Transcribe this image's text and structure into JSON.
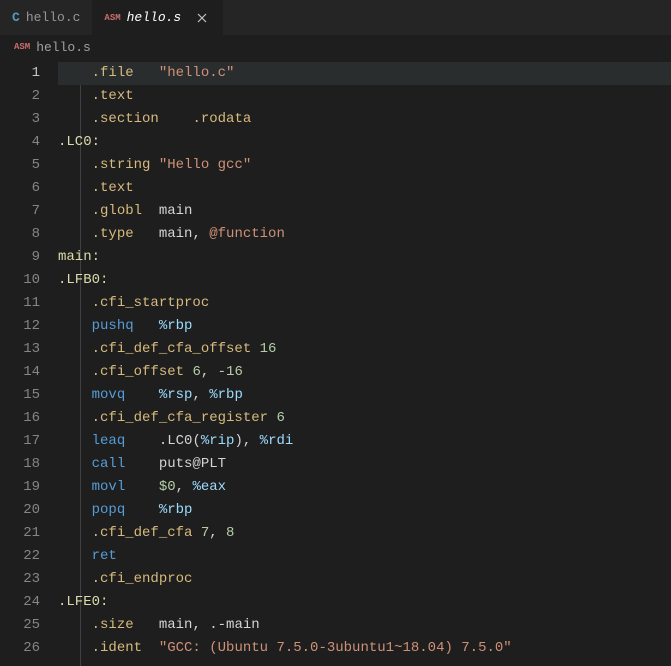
{
  "tabs": [
    {
      "icon": "C",
      "iconClass": "c-icon",
      "label": "hello.c",
      "active": false
    },
    {
      "icon": "ASM",
      "iconClass": "asm-icon",
      "label": "hello.s",
      "active": true
    }
  ],
  "breadcrumb": {
    "icon": "ASM",
    "label": "hello.s"
  },
  "activeLine": 1,
  "code": [
    [
      {
        "t": "    ",
        "c": "l"
      },
      {
        "t": ".file   ",
        "c": "d"
      },
      {
        "t": "\"hello.c\"",
        "c": "s"
      }
    ],
    [
      {
        "t": "    ",
        "c": "l"
      },
      {
        "t": ".text",
        "c": "d"
      }
    ],
    [
      {
        "t": "    ",
        "c": "l"
      },
      {
        "t": ".section    ",
        "c": "d"
      },
      {
        "t": ".rodata",
        "c": "d"
      }
    ],
    [
      {
        "t": ".LC0:",
        "c": "f"
      }
    ],
    [
      {
        "t": "    ",
        "c": "l"
      },
      {
        "t": ".string ",
        "c": "d"
      },
      {
        "t": "\"Hello gcc\"",
        "c": "s"
      }
    ],
    [
      {
        "t": "    ",
        "c": "l"
      },
      {
        "t": ".text",
        "c": "d"
      }
    ],
    [
      {
        "t": "    ",
        "c": "l"
      },
      {
        "t": ".globl  ",
        "c": "d"
      },
      {
        "t": "main",
        "c": "c"
      }
    ],
    [
      {
        "t": "    ",
        "c": "l"
      },
      {
        "t": ".type   ",
        "c": "d"
      },
      {
        "t": "main",
        "c": "c"
      },
      {
        "t": ", ",
        "c": "l"
      },
      {
        "t": "@function",
        "c": "at"
      }
    ],
    [
      {
        "t": "main:",
        "c": "f"
      }
    ],
    [
      {
        "t": ".LFB0:",
        "c": "f"
      }
    ],
    [
      {
        "t": "    ",
        "c": "l"
      },
      {
        "t": ".cfi_startproc",
        "c": "d"
      }
    ],
    [
      {
        "t": "    ",
        "c": "l"
      },
      {
        "t": "pushq   ",
        "c": "k"
      },
      {
        "t": "%rbp",
        "c": "r"
      }
    ],
    [
      {
        "t": "    ",
        "c": "l"
      },
      {
        "t": ".cfi_def_cfa_offset ",
        "c": "d"
      },
      {
        "t": "16",
        "c": "n"
      }
    ],
    [
      {
        "t": "    ",
        "c": "l"
      },
      {
        "t": ".cfi_offset ",
        "c": "d"
      },
      {
        "t": "6",
        "c": "n"
      },
      {
        "t": ", ",
        "c": "l"
      },
      {
        "t": "-16",
        "c": "n"
      }
    ],
    [
      {
        "t": "    ",
        "c": "l"
      },
      {
        "t": "movq    ",
        "c": "k"
      },
      {
        "t": "%rsp",
        "c": "r"
      },
      {
        "t": ", ",
        "c": "l"
      },
      {
        "t": "%rbp",
        "c": "r"
      }
    ],
    [
      {
        "t": "    ",
        "c": "l"
      },
      {
        "t": ".cfi_def_cfa_register ",
        "c": "d"
      },
      {
        "t": "6",
        "c": "n"
      }
    ],
    [
      {
        "t": "    ",
        "c": "l"
      },
      {
        "t": "leaq    ",
        "c": "k"
      },
      {
        "t": ".LC0",
        "c": "c"
      },
      {
        "t": "(",
        "c": "l"
      },
      {
        "t": "%rip",
        "c": "r"
      },
      {
        "t": "), ",
        "c": "l"
      },
      {
        "t": "%rdi",
        "c": "r"
      }
    ],
    [
      {
        "t": "    ",
        "c": "l"
      },
      {
        "t": "call    ",
        "c": "k"
      },
      {
        "t": "puts@PLT",
        "c": "c"
      }
    ],
    [
      {
        "t": "    ",
        "c": "l"
      },
      {
        "t": "movl    ",
        "c": "k"
      },
      {
        "t": "$0",
        "c": "n"
      },
      {
        "t": ", ",
        "c": "l"
      },
      {
        "t": "%eax",
        "c": "r"
      }
    ],
    [
      {
        "t": "    ",
        "c": "l"
      },
      {
        "t": "popq    ",
        "c": "k"
      },
      {
        "t": "%rbp",
        "c": "r"
      }
    ],
    [
      {
        "t": "    ",
        "c": "l"
      },
      {
        "t": ".cfi_def_cfa ",
        "c": "d"
      },
      {
        "t": "7",
        "c": "n"
      },
      {
        "t": ", ",
        "c": "l"
      },
      {
        "t": "8",
        "c": "n"
      }
    ],
    [
      {
        "t": "    ",
        "c": "l"
      },
      {
        "t": "ret",
        "c": "k"
      }
    ],
    [
      {
        "t": "    ",
        "c": "l"
      },
      {
        "t": ".cfi_endproc",
        "c": "d"
      }
    ],
    [
      {
        "t": ".LFE0:",
        "c": "f"
      }
    ],
    [
      {
        "t": "    ",
        "c": "l"
      },
      {
        "t": ".size   ",
        "c": "d"
      },
      {
        "t": "main",
        "c": "c"
      },
      {
        "t": ", ",
        "c": "l"
      },
      {
        "t": ".-main",
        "c": "c"
      }
    ],
    [
      {
        "t": "    ",
        "c": "l"
      },
      {
        "t": ".ident  ",
        "c": "d"
      },
      {
        "t": "\"GCC: (Ubuntu 7.5.0-3ubuntu1~18.04) 7.5.0\"",
        "c": "s"
      }
    ]
  ]
}
